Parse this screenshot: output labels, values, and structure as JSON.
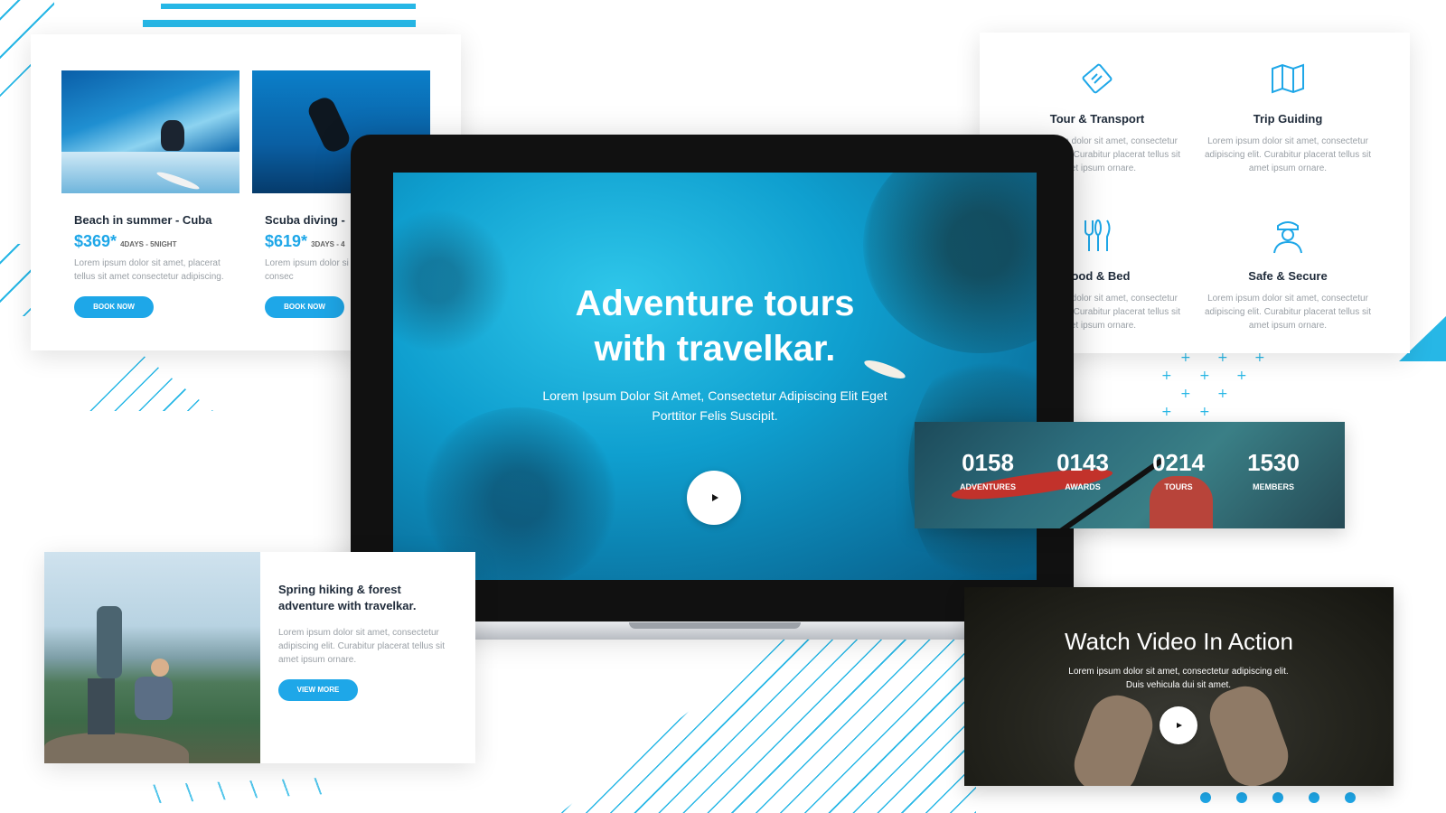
{
  "tours": [
    {
      "name": "Beach in summer - Cuba",
      "price": "$369*",
      "duration": "4DAYS - 5NIGHT",
      "desc": "Lorem ipsum dolor sit amet, placerat tellus sit amet consectetur adipiscing.",
      "button": "BOOK NOW"
    },
    {
      "name": "Scuba diving -",
      "price": "$619*",
      "duration": "3DAYS - 4",
      "desc": "Lorem ipsum dolor si tellus sit amet consec",
      "button": "BOOK NOW"
    }
  ],
  "services": [
    {
      "icon": "ticket-icon",
      "title": "Tour & Transport",
      "desc": "Lorem ipsum dolor sit amet, consectetur adipiscing elit. Curabitur placerat tellus sit amet ipsum ornare."
    },
    {
      "icon": "map-icon",
      "title": "Trip Guiding",
      "desc": "Lorem ipsum dolor sit amet, consectetur adipiscing elit. Curabitur placerat tellus sit amet ipsum ornare."
    },
    {
      "icon": "cutlery-icon",
      "title": "Food & Bed",
      "desc": "Lorem ipsum dolor sit amet, consectetur adipiscing elit. Curabitur placerat tellus sit amet ipsum ornare."
    },
    {
      "icon": "security-guard-icon",
      "title": "Safe & Secure",
      "desc": "Lorem ipsum dolor sit amet, consectetur adipiscing elit. Curabitur placerat tellus sit amet ipsum ornare."
    }
  ],
  "hero": {
    "title_line1": "Adventure tours",
    "title_line2": "with travelkar.",
    "subtitle": "Lorem Ipsum Dolor Sit Amet, Consectetur Adipiscing Elit Eget Porttitor Felis Suscipit."
  },
  "stats": [
    {
      "value": "0158",
      "label": "ADVENTURES"
    },
    {
      "value": "0143",
      "label": "AWARDS"
    },
    {
      "value": "0214",
      "label": "TOURS"
    },
    {
      "value": "1530",
      "label": "MEMBERS"
    }
  ],
  "hiking": {
    "title": "Spring hiking & forest adventure with travelkar.",
    "desc": "Lorem ipsum dolor sit amet, consectetur adipiscing elit. Curabitur placerat tellus sit amet ipsum ornare.",
    "button": "VIEW MORE"
  },
  "video": {
    "title": "Watch Video In Action",
    "desc": "Lorem ipsum dolor sit amet, consectetur adipiscing elit. Duis vehicula dui sit amet."
  },
  "colors": {
    "accent": "#1ea7e8",
    "decor": "#27b7e6"
  }
}
